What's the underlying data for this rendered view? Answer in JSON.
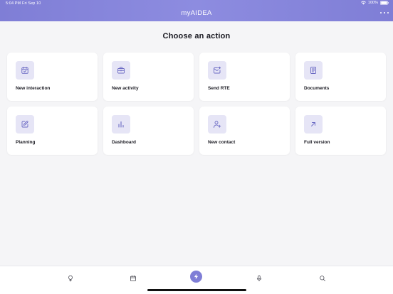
{
  "status_bar": {
    "time": "5:04 PM",
    "date": "Fri Sep 10",
    "battery": "100%"
  },
  "header": {
    "title": "myAIDEA"
  },
  "main": {
    "title": "Choose an action",
    "actions": [
      {
        "label": "New interaction",
        "icon": "calendar-check-icon"
      },
      {
        "label": "New activity",
        "icon": "briefcase-icon"
      },
      {
        "label": "Send RTE",
        "icon": "mail-send-icon"
      },
      {
        "label": "Documents",
        "icon": "document-icon"
      },
      {
        "label": "Planning",
        "icon": "edit-square-icon"
      },
      {
        "label": "Dashboard",
        "icon": "bar-chart-icon"
      },
      {
        "label": "New contact",
        "icon": "add-user-icon"
      },
      {
        "label": "Full version",
        "icon": "arrow-up-right-icon"
      }
    ]
  },
  "tab_bar": {
    "tabs": [
      {
        "icon": "lightbulb-icon",
        "active": false
      },
      {
        "icon": "calendar-icon",
        "active": false
      },
      {
        "icon": "lightning-icon",
        "active": true
      },
      {
        "icon": "microphone-icon",
        "active": false
      },
      {
        "icon": "search-icon",
        "active": false
      }
    ]
  },
  "colors": {
    "accent": "#7f7ed6",
    "icon_tile": "#e6e5f6",
    "background": "#f5f5f7"
  }
}
